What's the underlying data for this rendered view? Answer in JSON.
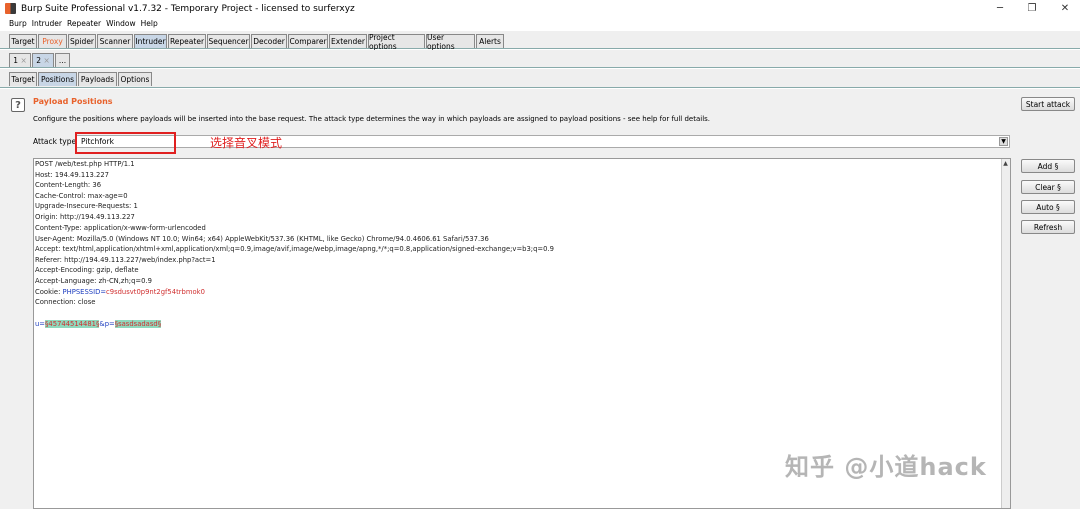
{
  "window": {
    "title": "Burp Suite Professional v1.7.32 - Temporary Project - licensed to surferxyz",
    "controls": [
      "─",
      "❐",
      "✕"
    ]
  },
  "menu": [
    "Burp",
    "Intruder",
    "Repeater",
    "Window",
    "Help"
  ],
  "main_tabs": [
    "Target",
    "Proxy",
    "Spider",
    "Scanner",
    "Intruder",
    "Repeater",
    "Sequencer",
    "Decoder",
    "Comparer",
    "Extender",
    "Project options",
    "User options",
    "Alerts"
  ],
  "num_tabs": [
    "1",
    "×",
    "2",
    "×",
    "..."
  ],
  "sub_tabs": [
    "Target",
    "Positions",
    "Payloads",
    "Options"
  ],
  "section": {
    "title": "Payload Positions",
    "description": "Configure the positions where payloads will be inserted into the base request. The attack type determines the way in which payloads are assigned to payload positions - see help for full details.",
    "attack_label": "Attack type:",
    "attack_value": "Pitchfork",
    "annotation": "选择音叉模式"
  },
  "request": {
    "lines": [
      "POST /web/test.php HTTP/1.1",
      "Host: 194.49.113.227",
      "Content-Length: 36",
      "Cache-Control: max-age=0",
      "Upgrade-Insecure-Requests: 1",
      "Origin: http://194.49.113.227",
      "Content-Type: application/x-www-form-urlencoded",
      "User-Agent: Mozilla/5.0 (Windows NT 10.0; Win64; x64) AppleWebKit/537.36 (KHTML, like Gecko) Chrome/94.0.4606.61 Safari/537.36",
      "Accept: text/html,application/xhtml+xml,application/xml;q=0.9,image/avif,image/webp,image/apng,*/*;q=0.8,application/signed-exchange;v=b3;q=0.9",
      "Referer: http://194.49.113.227/web/index.php?act=1",
      "Accept-Encoding: gzip, deflate",
      "Accept-Language: zh-CN,zh;q=0.9"
    ],
    "cookie_label": "Cookie: ",
    "cookie_name": "PHPSESSID=",
    "cookie_value": "c9sdusvt0p9nt2gf54trbmok0",
    "connection": "Connection: close",
    "body_u": "u=",
    "body_u_val": "§45744514481§",
    "body_amp": "&p=",
    "body_p_val": "§sasdsadasd§"
  },
  "buttons": {
    "start_attack": "Start attack",
    "add": "Add §",
    "clear": "Clear §",
    "auto": "Auto §",
    "refresh": "Refresh"
  },
  "watermark": "知乎 @小道hack"
}
